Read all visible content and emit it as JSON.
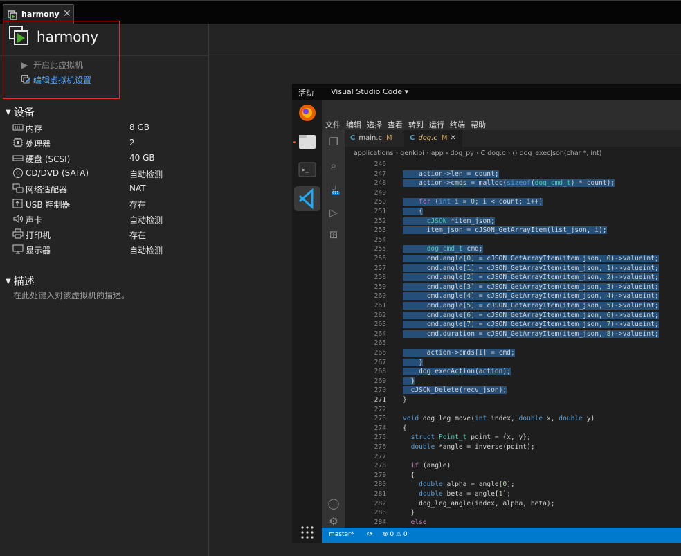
{
  "tab": {
    "label": "harmony",
    "close": "✕"
  },
  "vm": {
    "title": "harmony",
    "actions": [
      {
        "label": "开启此虚拟机",
        "icon": "play-icon"
      },
      {
        "label": "编辑虚拟机设置",
        "icon": "edit-settings-icon"
      }
    ]
  },
  "devices": {
    "heading": "设备",
    "items": [
      {
        "name": "内存",
        "value": "8 GB",
        "icon": "memory-icon"
      },
      {
        "name": "处理器",
        "value": "2",
        "icon": "cpu-icon"
      },
      {
        "name": "硬盘 (SCSI)",
        "value": "40 GB",
        "icon": "harddisk-icon"
      },
      {
        "name": "CD/DVD (SATA)",
        "value": "自动检测",
        "icon": "cdrom-icon"
      },
      {
        "name": "网络适配器",
        "value": "NAT",
        "icon": "network-icon"
      },
      {
        "name": "USB 控制器",
        "value": "存在",
        "icon": "usb-icon"
      },
      {
        "name": "声卡",
        "value": "自动检测",
        "icon": "sound-icon"
      },
      {
        "name": "打印机",
        "value": "存在",
        "icon": "printer-icon"
      },
      {
        "name": "显示器",
        "value": "自动检测",
        "icon": "display-icon"
      }
    ]
  },
  "description": {
    "heading": "描述",
    "placeholder": "在此处键入对该虚拟机的描述。"
  },
  "guest": {
    "activities": "活动",
    "app_name": "Visual Studio Code ▾",
    "menu": [
      "文件",
      "编辑",
      "选择",
      "查看",
      "转到",
      "运行",
      "终端",
      "帮助"
    ],
    "editor_tabs": [
      {
        "label": "main.c",
        "mod": "M",
        "active": false
      },
      {
        "label": "dog.c",
        "mod": "M",
        "active": true
      }
    ],
    "editor_tab_close": "✕",
    "breadcrumbs": "applications › genkipi › app › dog_py › C dog.c › ⟨⟩ dog_execJson(char *, int)",
    "status": {
      "branch": "master*",
      "sync": "⟳",
      "problems": "⊗ 0 ⚠ 0"
    },
    "badge": "611",
    "code": [
      {
        "n": "246",
        "t": ""
      },
      {
        "n": "247",
        "t": "    action->len = count;"
      },
      {
        "n": "248",
        "t": "    action->cmds = malloc(sizeof(dog_cmd_t) * count);"
      },
      {
        "n": "249",
        "t": ""
      },
      {
        "n": "250",
        "t": "    for (int i = 0; i < count; i++)"
      },
      {
        "n": "251",
        "t": "    {"
      },
      {
        "n": "252",
        "t": "      cJSON *item_json;"
      },
      {
        "n": "253",
        "t": "      item_json = cJSON_GetArrayItem(list_json, i);"
      },
      {
        "n": "254",
        "t": ""
      },
      {
        "n": "255",
        "t": "      dog_cmd_t cmd;"
      },
      {
        "n": "256",
        "t": "      cmd.angle[0] = cJSON_GetArrayItem(item_json, 0)->valueint;"
      },
      {
        "n": "257",
        "t": "      cmd.angle[1] = cJSON_GetArrayItem(item_json, 1)->valueint;"
      },
      {
        "n": "258",
        "t": "      cmd.angle[2] = cJSON_GetArrayItem(item_json, 2)->valueint;"
      },
      {
        "n": "259",
        "t": "      cmd.angle[3] = cJSON_GetArrayItem(item_json, 3)->valueint;"
      },
      {
        "n": "260",
        "t": "      cmd.angle[4] = cJSON_GetArrayItem(item_json, 4)->valueint;"
      },
      {
        "n": "261",
        "t": "      cmd.angle[5] = cJSON_GetArrayItem(item_json, 5)->valueint;"
      },
      {
        "n": "262",
        "t": "      cmd.angle[6] = cJSON_GetArrayItem(item_json, 6)->valueint;"
      },
      {
        "n": "263",
        "t": "      cmd.angle[7] = cJSON_GetArrayItem(item_json, 7)->valueint;"
      },
      {
        "n": "264",
        "t": "      cmd.duration = cJSON_GetArrayItem(item_json, 8)->valueint;"
      },
      {
        "n": "265",
        "t": ""
      },
      {
        "n": "266",
        "t": "      action->cmds[i] = cmd;"
      },
      {
        "n": "267",
        "t": "    }"
      },
      {
        "n": "268",
        "t": "    dog_execAction(action);"
      },
      {
        "n": "269",
        "t": "  }"
      },
      {
        "n": "270",
        "t": "  cJSON_Delete(recv_json);"
      },
      {
        "n": "271",
        "t": "}"
      },
      {
        "n": "272",
        "t": ""
      },
      {
        "n": "273",
        "t": "void dog_leg_move(int index, double x, double y)"
      },
      {
        "n": "274",
        "t": "{"
      },
      {
        "n": "275",
        "t": "  struct Point_t point = {x, y};"
      },
      {
        "n": "276",
        "t": "  double *angle = inverse(point);"
      },
      {
        "n": "277",
        "t": ""
      },
      {
        "n": "278",
        "t": "  if (angle)"
      },
      {
        "n": "279",
        "t": "  {"
      },
      {
        "n": "280",
        "t": "    double alpha = angle[0];"
      },
      {
        "n": "281",
        "t": "    double beta = angle[1];"
      },
      {
        "n": "282",
        "t": "    dog_leg_angle(index, alpha, beta);"
      },
      {
        "n": "283",
        "t": "  }"
      },
      {
        "n": "284",
        "t": "  else"
      }
    ],
    "current_line": "271",
    "selected_lines": [
      "246",
      "247",
      "248",
      "249",
      "250",
      "251",
      "252",
      "253",
      "254",
      "255",
      "256",
      "257",
      "258",
      "259",
      "260",
      "261",
      "262",
      "263",
      "264",
      "265",
      "266",
      "267",
      "268",
      "269",
      "270"
    ]
  },
  "colors": {
    "accent_link": "#5aa9ff",
    "highlight_box": "#e03030",
    "vscode_status": "#007acc",
    "selection": "#264f78"
  }
}
